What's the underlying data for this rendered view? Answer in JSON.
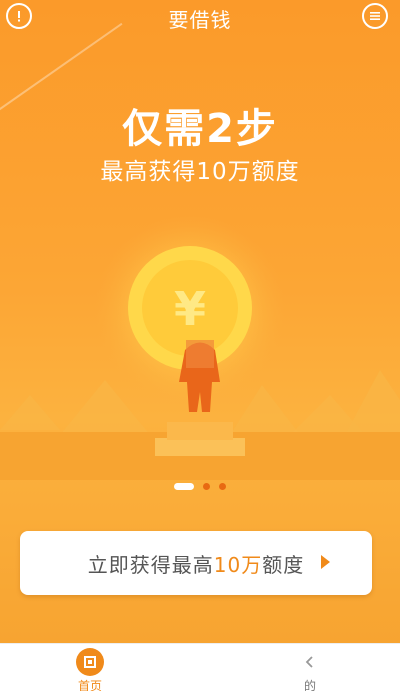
{
  "header": {
    "title": "要借钱",
    "left_icon": "info-icon",
    "right_icon": "message-icon"
  },
  "hero": {
    "title": "仅需2步",
    "subtitle": "最高获得10万额度"
  },
  "carousel": {
    "current": 1,
    "total": 3
  },
  "cta": {
    "prefix": "立即获得最高",
    "amount": "10万",
    "suffix": "额度",
    "icon": "chevron-right-icon"
  },
  "tabbar": {
    "home_label": "首页",
    "mine_label": "的"
  },
  "colors": {
    "primary": "#f08a1a",
    "background": "#fca635"
  }
}
